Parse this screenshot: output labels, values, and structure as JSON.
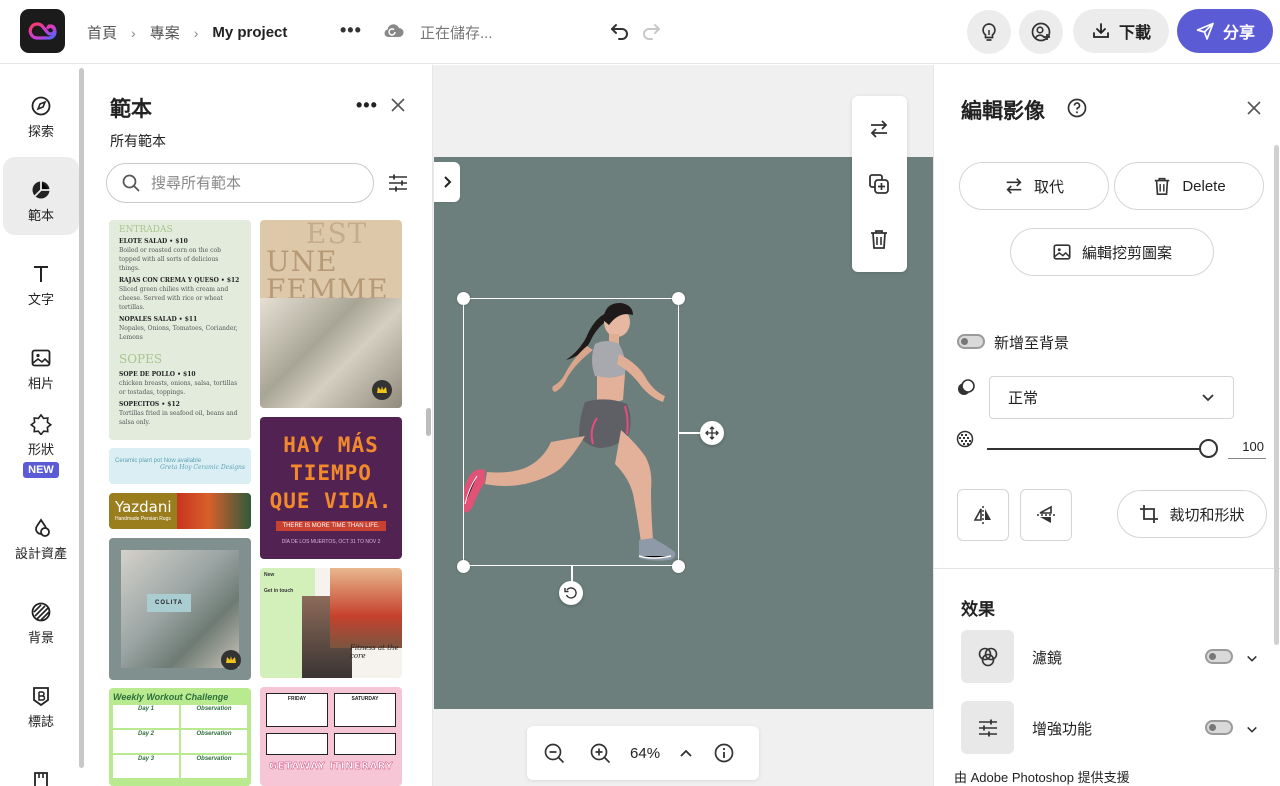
{
  "header": {
    "breadcrumbs": [
      "首頁",
      "專案"
    ],
    "project_name": "My project",
    "more_label": "•••",
    "save_status": "正在儲存...",
    "download_label": "下載",
    "share_label": "分享"
  },
  "rail": {
    "items": [
      {
        "label": "探索",
        "icon": "compass-icon"
      },
      {
        "label": "範本",
        "icon": "templates-icon"
      },
      {
        "label": "文字",
        "icon": "text-icon"
      },
      {
        "label": "相片",
        "icon": "photo-icon"
      },
      {
        "label": "形狀",
        "icon": "shape-icon",
        "badge": "NEW"
      },
      {
        "label": "設計資產",
        "icon": "design-assets-icon"
      },
      {
        "label": "背景",
        "icon": "background-icon"
      },
      {
        "label": "標誌",
        "icon": "logo-icon"
      }
    ],
    "active": "範本"
  },
  "templates_panel": {
    "title": "範本",
    "subtitle": "所有範本",
    "more_label": "•••",
    "search_placeholder": "搜尋所有範本",
    "tiles": {
      "menu": {
        "heading": "ENTRADAS",
        "lines": [
          {
            "name": "ELOTE SALAD • $10",
            "desc": "Boiled or roasted corn on the cob topped with all sorts of delicious things."
          },
          {
            "name": "RAJAS CON CREMA Y QUESO • $12",
            "desc": "Sliced green chilies with cream and cheese. Served with rice or wheat tortillas."
          },
          {
            "name": "NOPALES SALAD • $11",
            "desc": "Nopales, Onions, Tomatoes, Coriander, Lemons"
          }
        ],
        "section": "SOPES",
        "lines2": [
          {
            "name": "SOPE DE POLLO • $10",
            "desc": "chicken breasts, onions, salsa, tortillas or tostadas, toppings."
          },
          {
            "name": "SOPECITOS • $12",
            "desc": "Tortillas fried in seafood oil, beans and salsa only."
          }
        ]
      },
      "est": {
        "line1": "EST",
        "line2": "UNE",
        "line3": "FEMME"
      },
      "plant": {
        "left": "Ceramic plant pot\nNow available",
        "right": "Greta Hoy\nCeramic Designs"
      },
      "yazdani": {
        "name": "Yazdani",
        "sub": "Handmade Persian Rugs"
      },
      "hay": {
        "line1": "HAY MÁS",
        "line2": "TIEMPO",
        "line3": "QUE VIDA.",
        "strip": "THERE IS MORE TIME THAN LIFE.",
        "foot": "DÍA DE LOS MUERTOS, OCT 31 TO NOV 2"
      },
      "colita": {
        "card": "COLITA"
      },
      "fitness": {
        "new": "New",
        "get": "Get in touch",
        "tagline": "Fitness at the core"
      },
      "workout": {
        "title": "Weekly Workout Challenge",
        "cells": [
          "Day 1",
          "Observation",
          "Day 2",
          "Observation",
          "Day 3",
          "Observation"
        ]
      },
      "getaway": {
        "days": [
          "FRIDAY",
          "SATURDAY"
        ],
        "title": "GETAWAY ITINERARY"
      }
    }
  },
  "canvas": {
    "zoom": "64%",
    "artboard_color": "#6c7f7c"
  },
  "edit_panel": {
    "title": "編輯影像",
    "replace_label": "取代",
    "delete_label": "Delete",
    "cutout_label": "編輯挖剪圖案",
    "add_bg_label": "新增至背景",
    "blend_mode": "正常",
    "opacity_value": "100",
    "crop_label": "裁切和形狀",
    "effects_title": "效果",
    "effects": [
      {
        "label": "濾鏡",
        "icon": "filter-icon"
      },
      {
        "label": "增強功能",
        "icon": "adjust-icon"
      }
    ],
    "footer": "由 Adobe Photoshop 提供支援"
  },
  "colors": {
    "accent": "#5b5bd6",
    "artboard": "#6c7f7c"
  }
}
